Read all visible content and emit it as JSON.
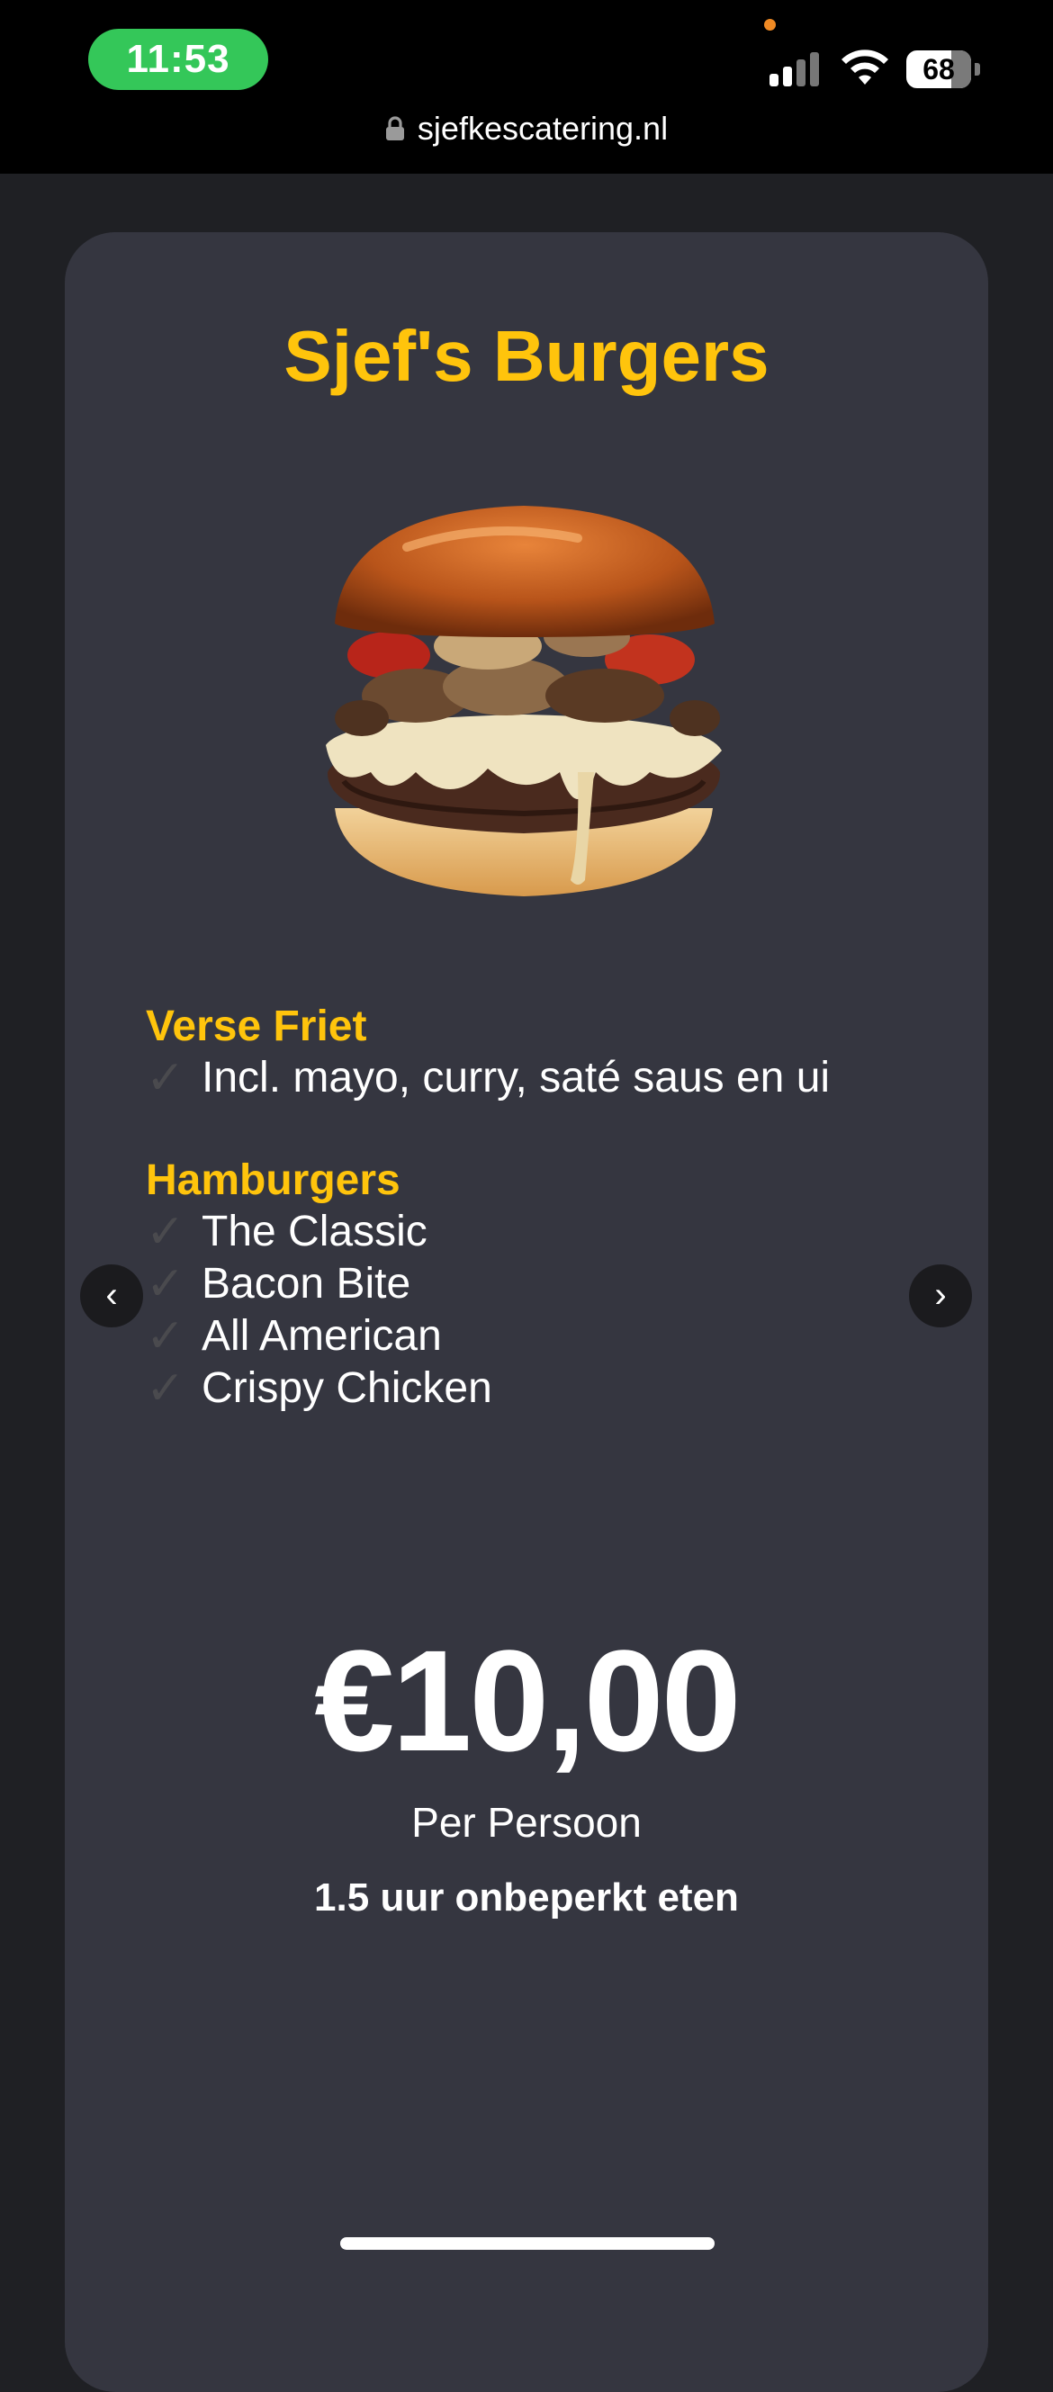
{
  "status_bar": {
    "time": "11:53",
    "battery": "68",
    "url": "sjefkescatering.nl"
  },
  "card": {
    "title": "Sjef's Burgers",
    "image_alt": "burger-with-mushrooms-and-cheese",
    "sections": [
      {
        "heading": "Verse Friet",
        "items": [
          "Incl. mayo, curry, saté saus en ui"
        ]
      },
      {
        "heading": "Hamburgers",
        "items": [
          "The Classic",
          "Bacon Bite",
          "All American",
          "Crispy Chicken"
        ]
      }
    ],
    "price": "€10,00",
    "price_unit": "Per Persoon",
    "duration": "1.5 uur onbeperkt eten",
    "check_glyph": "✓",
    "prev_glyph": "‹",
    "next_glyph": "›"
  },
  "colors": {
    "accent": "#ffc40c",
    "card_bg": "#353640",
    "page_bg": "#1f2024",
    "status_green": "#34c759"
  }
}
